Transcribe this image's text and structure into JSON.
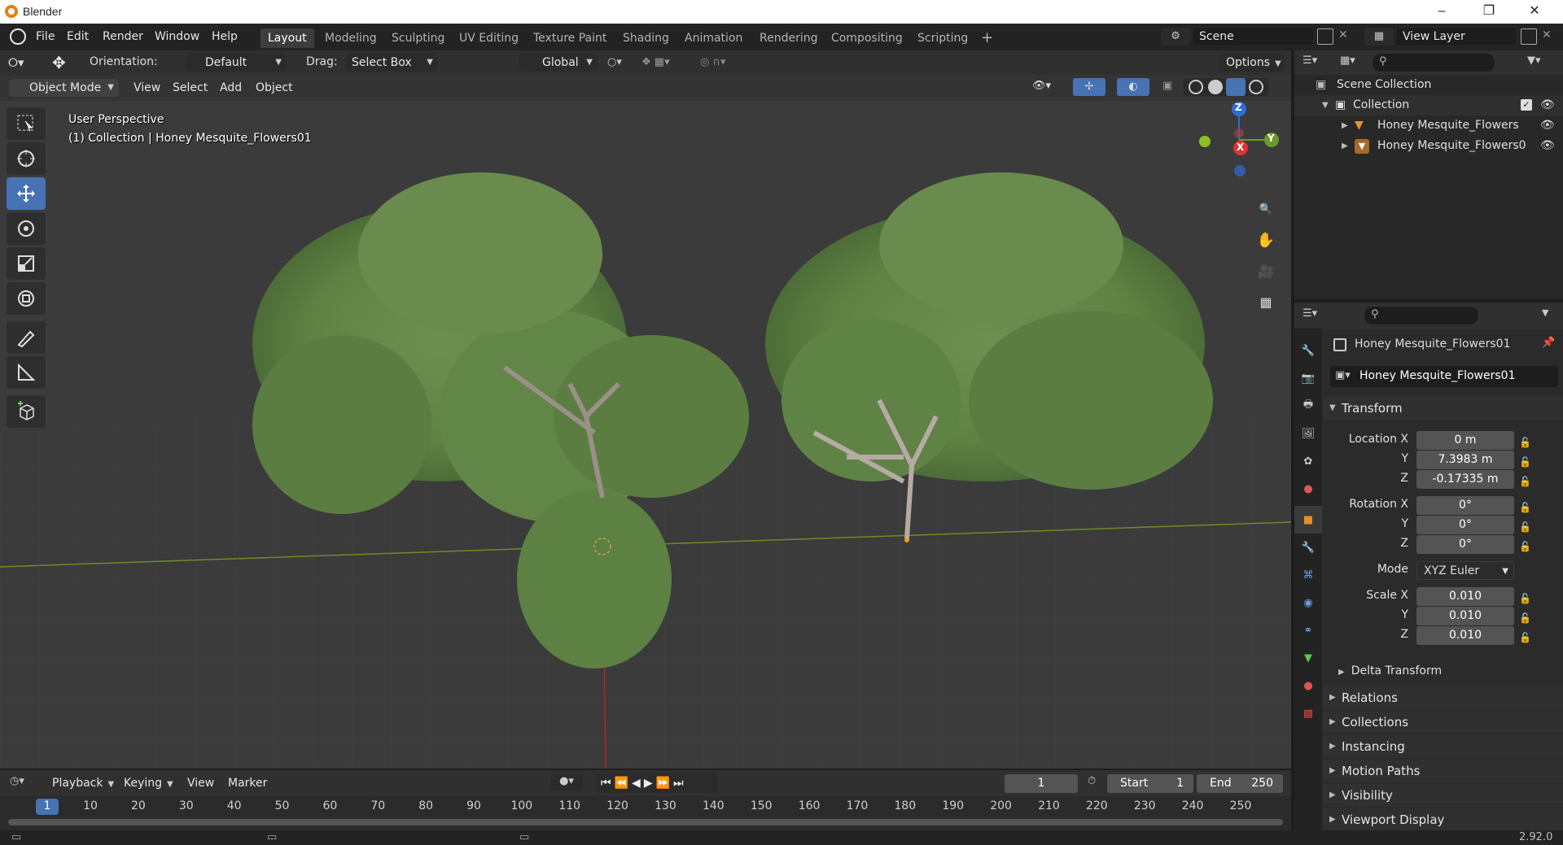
{
  "window": {
    "title": "Blender"
  },
  "menus": [
    "File",
    "Edit",
    "Render",
    "Window",
    "Help"
  ],
  "workspaces": [
    "Layout",
    "Modeling",
    "Sculpting",
    "UV Editing",
    "Texture Paint",
    "Shading",
    "Animation",
    "Rendering",
    "Compositing",
    "Scripting"
  ],
  "active_workspace": "Layout",
  "scene_name": "Scene",
  "view_layer": "View Layer",
  "tool_header": {
    "orientation_label": "Orientation:",
    "orientation_value": "Default",
    "drag_label": "Drag:",
    "drag_value": "Select Box",
    "transform_orientation": "Global",
    "options_label": "Options"
  },
  "viewport_header": {
    "mode": "Object Mode",
    "menus": [
      "View",
      "Select",
      "Add",
      "Object"
    ]
  },
  "viewport": {
    "perspective_label": "User Perspective",
    "collection_label": "(1) Collection | Honey Mesquite_Flowers01",
    "gizmo_axes": [
      "X",
      "Y",
      "Z"
    ]
  },
  "outliner": {
    "root": "Scene Collection",
    "collection": "Collection",
    "objects": [
      "Honey Mesquite_Flowers",
      "Honey Mesquite_Flowers0"
    ]
  },
  "properties": {
    "object_title": "Honey Mesquite_Flowers01",
    "object_name_field": "Honey Mesquite_Flowers01",
    "transform_title": "Transform",
    "location_label": "Location X",
    "location": [
      "0 m",
      "7.3983 m",
      "-0.17335 m"
    ],
    "rotation_label": "Rotation X",
    "rotation": [
      "0°",
      "0°",
      "0°"
    ],
    "mode_label": "Mode",
    "mode_value": "XYZ Euler",
    "scale_label": "Scale X",
    "scale": [
      "0.010",
      "0.010",
      "0.010"
    ],
    "axis_y": "Y",
    "axis_z": "Z",
    "subpanels": [
      "Delta Transform"
    ],
    "panels": [
      "Relations",
      "Collections",
      "Instancing",
      "Motion Paths",
      "Visibility",
      "Viewport Display"
    ]
  },
  "timeline": {
    "menus": [
      "Playback",
      "Keying",
      "View",
      "Marker"
    ],
    "current_frame": "1",
    "start_label": "Start",
    "start_value": "1",
    "end_label": "End",
    "end_value": "250",
    "ticks": [
      "1",
      "10",
      "20",
      "30",
      "40",
      "50",
      "60",
      "70",
      "80",
      "90",
      "100",
      "110",
      "120",
      "130",
      "140",
      "150",
      "160",
      "170",
      "180",
      "190",
      "200",
      "210",
      "220",
      "230",
      "240",
      "250"
    ]
  },
  "status": {
    "version": "2.92.0"
  },
  "colors": {
    "accent": "#4772b3",
    "foliage": "#6e8f4c",
    "header": "#303030",
    "panel": "#2b2b2b"
  }
}
